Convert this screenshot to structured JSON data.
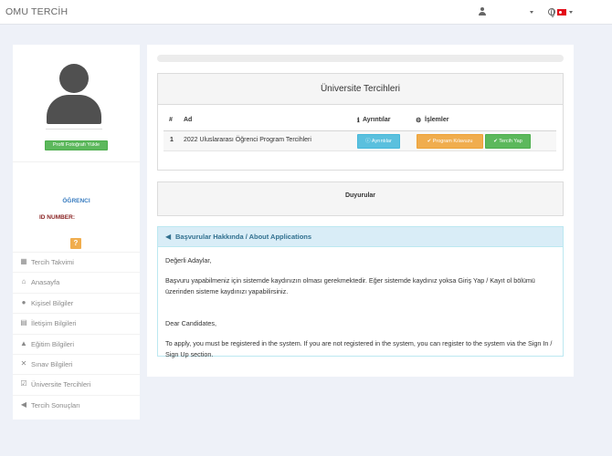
{
  "topbar": {
    "brand": "OMU TERCİH"
  },
  "sidebar": {
    "upload_label": "Profil Fotoğrafı Yükle",
    "role": "ÖĞRENCI",
    "id_label": "ID NUMBER:",
    "help": "?",
    "menu": [
      {
        "icon": "calendar-icon",
        "label": "Tercih Takvimi"
      },
      {
        "icon": "home-icon",
        "label": "Anasayfa"
      },
      {
        "icon": "user-icon",
        "label": "Kişisel Bilgiler"
      },
      {
        "icon": "contact-card-icon",
        "label": "İletişim Bilgileri"
      },
      {
        "icon": "graduation-cap-icon",
        "label": "Eğitim Bilgileri"
      },
      {
        "icon": "tools-icon",
        "label": "Sınav Bilgileri"
      },
      {
        "icon": "checkbox-icon",
        "label": "Üniversite Tercihleri"
      },
      {
        "icon": "bullhorn-icon",
        "label": "Tercih Sonuçları"
      }
    ]
  },
  "preferences": {
    "title": "Üniversite Tercihleri",
    "columns": {
      "num": "#",
      "name": "Ad",
      "details": "Ayrıntılar",
      "actions": "İşlemler"
    },
    "rows": [
      {
        "num": "1",
        "name": "2022 Uluslararası Öğrenci Program Tercihleri",
        "details_btn": "Ayrıntılar",
        "quota_btn": "Program Kılavuzu",
        "apply_btn": "Tercih Yap"
      }
    ]
  },
  "announcements": {
    "title": "Duyurular"
  },
  "applications": {
    "title": "Başvurular Hakkında / About Applications",
    "tr_greeting": "Değerli Adaylar,",
    "tr_text": "Başvuru yapabilmeniz için sistemde kaydınızın olması gerekmektedir. Eğer sistemde kaydınız yoksa Giriş Yap / Kayıt ol bölümü üzerinden sisteme kaydınızı yapabilirsiniz.",
    "en_greeting": "Dear Candidates,",
    "en_text": "To apply, you must be registered in the system. If you are not registered in the system, you can register to the system via the Sign In / Sign Up section."
  }
}
